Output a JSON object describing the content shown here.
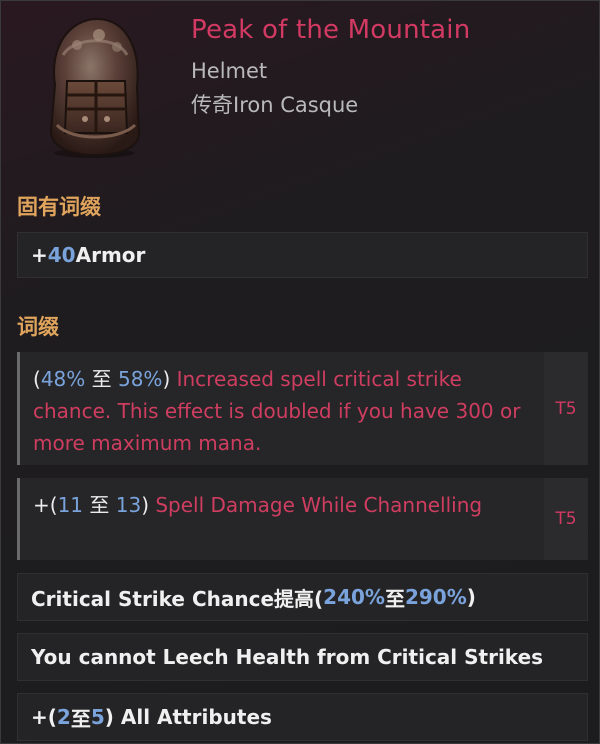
{
  "item": {
    "name": "Peak of the Mountain",
    "type": "Helmet",
    "base": "传奇Iron Casque",
    "icon": "helmet-icon"
  },
  "implicit": {
    "title": "固有词缀",
    "lines": [
      {
        "prefix": "+",
        "value": "40",
        "text": " Armor"
      }
    ]
  },
  "affixes": {
    "title": "词缀",
    "items": [
      {
        "open": "(",
        "min": "48%",
        "to": " 至 ",
        "max": "58%",
        "close": ")",
        "text": " Increased spell critical strike chance. This effect is doubled if you have 300 or more maximum mana.",
        "tier": "T5"
      },
      {
        "open": "+(",
        "min": "11",
        "to": " 至 ",
        "max": "13",
        "close": ")",
        "text": " Spell Damage While Channelling",
        "tier": "T5"
      }
    ],
    "lines": [
      {
        "text": "Critical Strike Chance提高(",
        "min": "240%",
        "to": " 至 ",
        "max": "290%",
        "close": ")"
      },
      {
        "text": "You cannot Leech Health from Critical Strikes"
      },
      {
        "text": "+(",
        "min": "2",
        "to": " 至 ",
        "max": "5",
        "close": ") All Attributes"
      }
    ]
  },
  "colors": {
    "name": "#d23a63",
    "affix": "#cf3d60",
    "number": "#7aa3dc",
    "section_title": "#e0a45c"
  }
}
